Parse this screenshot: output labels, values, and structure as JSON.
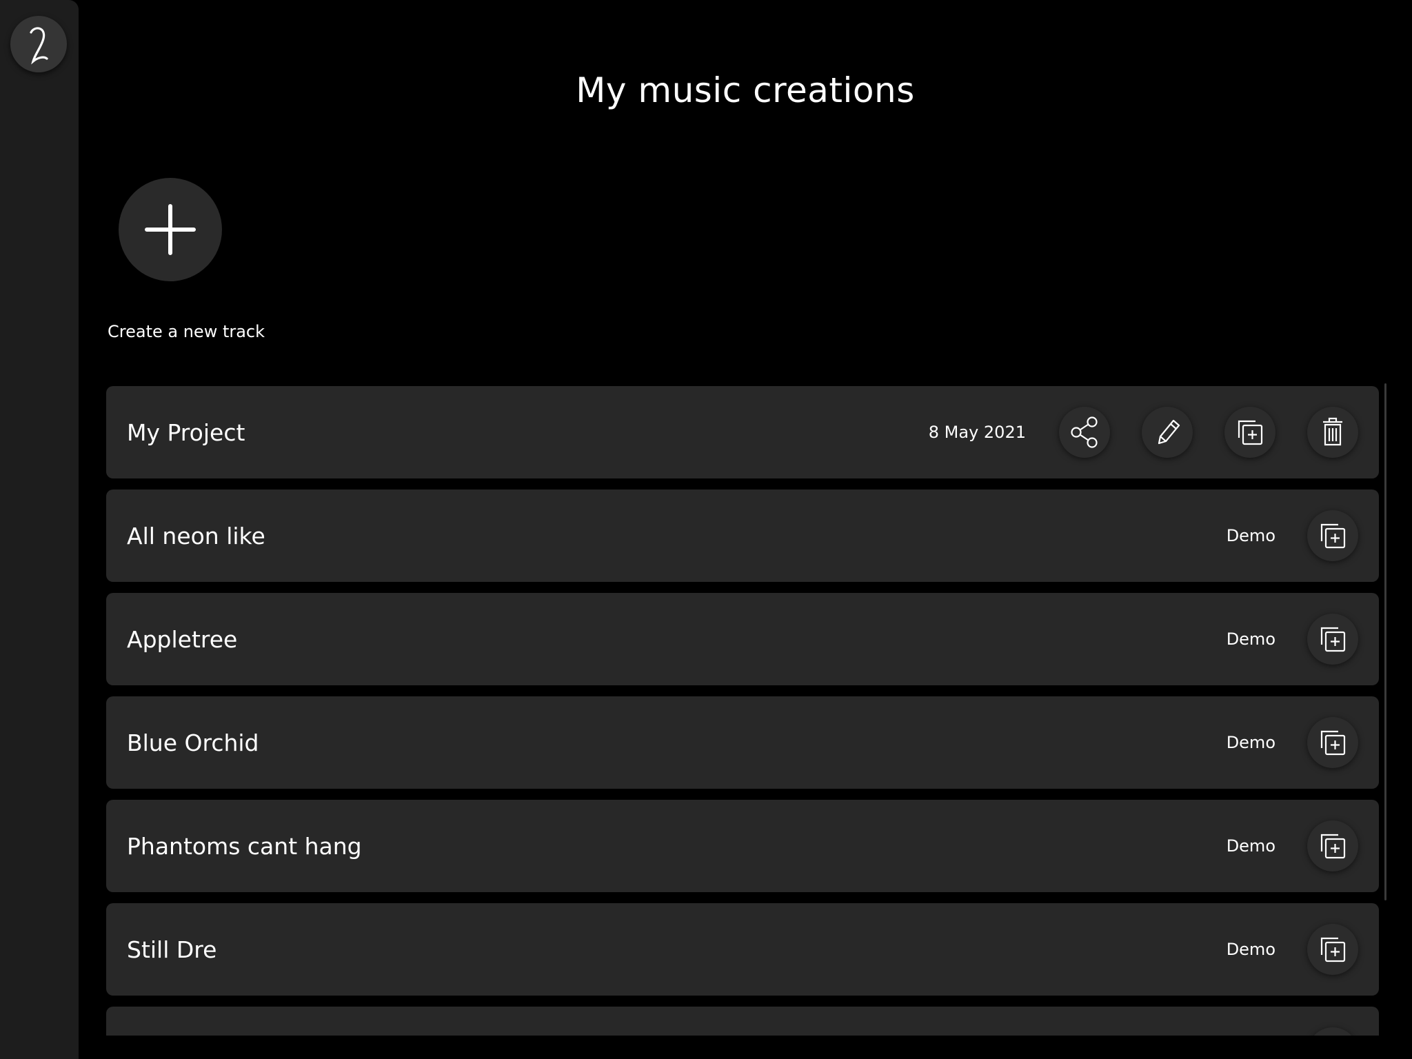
{
  "header": {
    "title": "My music creations"
  },
  "create": {
    "label": "Create a new track"
  },
  "icons": {
    "logo": "logo-icon",
    "plus": "plus-icon",
    "share": "share-icon",
    "edit": "pencil-icon",
    "duplicate": "duplicate-icon",
    "delete": "trash-icon"
  },
  "tracks": [
    {
      "name": "My Project",
      "meta": "8 May 2021"
    },
    {
      "name": "All neon like",
      "meta": "Demo"
    },
    {
      "name": "Appletree",
      "meta": "Demo"
    },
    {
      "name": "Blue Orchid",
      "meta": "Demo"
    },
    {
      "name": "Phantoms cant hang",
      "meta": "Demo"
    },
    {
      "name": "Still Dre",
      "meta": "Demo"
    },
    {
      "name": "",
      "meta": ""
    }
  ]
}
